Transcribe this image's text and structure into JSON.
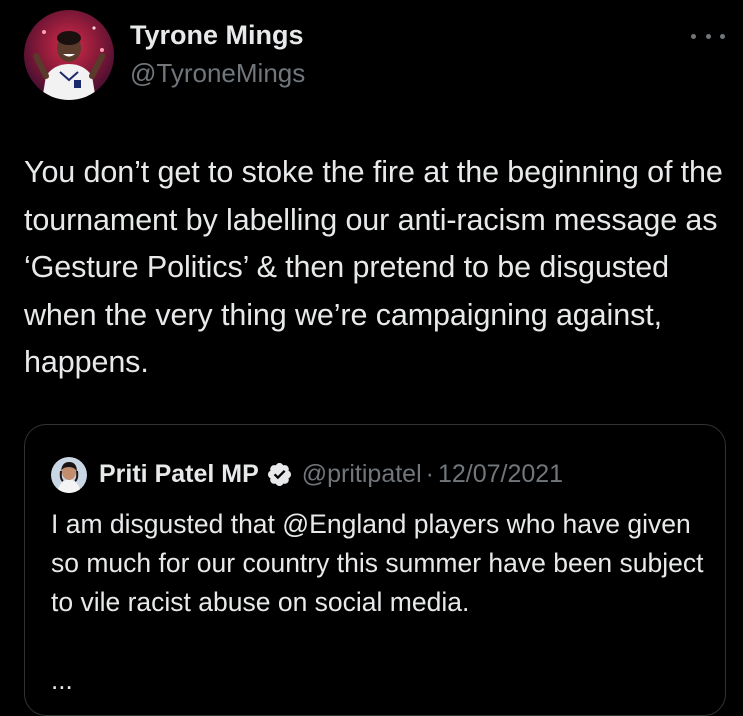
{
  "author": {
    "display_name": "Tyrone Mings",
    "handle": "@TyroneMings",
    "avatar_icon": "profile-photo"
  },
  "more_icon": "more-options-icon",
  "tweet_text": "You don’t get to stoke the fire at the beginning of the tournament by labelling our anti-racism message as ‘Gesture Politics’ & then pretend to be disgusted when the very thing we’re campaigning against, happens.",
  "quoted": {
    "display_name": "Priti Patel MP",
    "verified_icon": "verified-badge-icon",
    "handle": "@pritipatel",
    "separator": "·",
    "date": "12/07/2021",
    "text": "I am disgusted that @England players who have given so much for our country this summer have been subject to vile racist abuse on social media.",
    "ellipsis": "..."
  },
  "colors": {
    "background": "#000000",
    "text_primary": "#e7e9ea",
    "text_secondary": "#71767b",
    "border": "#2f3336",
    "verified": "#e7e9ea"
  }
}
